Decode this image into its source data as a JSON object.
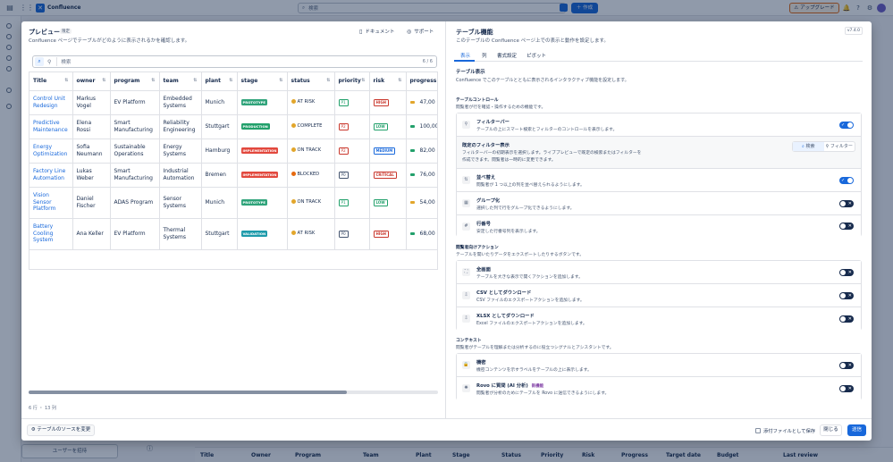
{
  "app": {
    "name": "Confluence",
    "search_placeholder": "検索",
    "create_label": "作成",
    "upgrade_label": "アップグレード",
    "invite_label": "ユーザーを招待"
  },
  "bg_table_headers": [
    "Title",
    "Owner",
    "Program",
    "Team",
    "Plant",
    "Stage",
    "Status",
    "Priority",
    "Risk",
    "Progress",
    "Target date",
    "Budget",
    "Last review"
  ],
  "preview": {
    "title": "プレビュー",
    "badge": "限定",
    "description": "Confluence ページでテーブルがどのように表示されるかを確認します。",
    "doc_link": "ドキュメント",
    "support_link": "サポート",
    "search_placeholder": "検索",
    "count": "6 / 6",
    "row_info": "6 行 ・ 13 列",
    "columns": [
      "Title",
      "owner",
      "program",
      "team",
      "plant",
      "stage",
      "status",
      "priority",
      "risk",
      "progress"
    ],
    "rows": [
      {
        "title": "Control Unit Redesign",
        "owner": "Markus Vogel",
        "program": "EV Platform",
        "team": "Embedded Systems",
        "plant": "Munich",
        "stage": "PROTOTYPE",
        "status": "AT RISK",
        "priority": "P1",
        "risk": "HIGH",
        "progress": "47,00"
      },
      {
        "title": "Predictive Maintenance",
        "owner": "Elena Rossi",
        "program": "Smart Manufacturing",
        "team": "Reliability Engineering",
        "plant": "Stuttgart",
        "stage": "PRODUCTION",
        "status": "COMPLETE",
        "priority": "P2",
        "risk": "LOW",
        "progress": "100,00"
      },
      {
        "title": "Energy Optimization",
        "owner": "Sofia Neumann",
        "program": "Sustainable Operations",
        "team": "Energy Systems",
        "plant": "Hamburg",
        "stage": "IMPLEMENTATION",
        "status": "ON TRACK",
        "priority": "P2",
        "risk": "MEDIUM",
        "progress": "82,00"
      },
      {
        "title": "Factory Line Automation",
        "owner": "Lukas Weber",
        "program": "Smart Manufacturing",
        "team": "Industrial Automation",
        "plant": "Bremen",
        "stage": "IMPLEMENTATION",
        "status": "BLOCKED",
        "priority": "P0",
        "risk": "CRITICAL",
        "progress": "76,00"
      },
      {
        "title": "Vision Sensor Platform",
        "owner": "Daniel Fischer",
        "program": "ADAS Program",
        "team": "Sensor Systems",
        "plant": "Munich",
        "stage": "PROTOTYPE",
        "status": "ON TRACK",
        "priority": "P1",
        "risk": "LOW",
        "progress": "54,00"
      },
      {
        "title": "Battery Cooling System",
        "owner": "Ana Keller",
        "program": "EV Platform",
        "team": "Thermal Systems",
        "plant": "Stuttgart",
        "stage": "VALIDATION",
        "status": "AT RISK",
        "priority": "P0",
        "risk": "HIGH",
        "progress": "68,00"
      }
    ],
    "colors": {
      "stage": {
        "PROTOTYPE": "#2fa37a",
        "PRODUCTION": "#22a06b",
        "IMPLEMENTATION": "#e2483d",
        "VALIDATION": "#1d9aaa"
      },
      "status": {
        "AT RISK": "#e2a62b",
        "COMPLETE": "#e2a62b",
        "ON TRACK": "#e2a62b",
        "BLOCKED": "#e56910"
      },
      "priority": {
        "P1": "#22a06b",
        "P2": "#c9372c",
        "P0": "#44546f"
      },
      "risk": {
        "HIGH": "#c9372c",
        "LOW": "#22a06b",
        "MEDIUM": "#1868db",
        "CRITICAL": "#c9372c"
      },
      "progress": {
        "47,00": "#e2a62b",
        "100,00": "#22a06b",
        "82,00": "#22a06b",
        "76,00": "#22a06b",
        "54,00": "#e2a62b",
        "68,00": "#22a06b"
      }
    }
  },
  "settings": {
    "title": "テーブル機能",
    "description": "このテーブルの Confluence ページ上での表示と動作を設定します。",
    "version": "v7.4.0",
    "tabs": [
      "表示",
      "列",
      "書式設定",
      "ピボット"
    ],
    "display_heading": "テーブル表示",
    "display_desc": "Confluence でこのテーブルとともに表示されるインタラクティブ機能を設定します。",
    "controls_heading": "テーブルコントロール",
    "controls_desc": "閲覧者が行を確認・操作するための機能です。",
    "filterbar_title": "フィルターバー",
    "filterbar_desc": "テーブルの上にスマート検索とフィルターのコントロールを表示します。",
    "default_filter_title": "既定のフィルター表示",
    "default_filter_desc1": "フィルターバーの初期表示を選択します。ライブプレビューで既定の検索またはフィルターを",
    "default_filter_desc2": "作成できます。閲覧者は一時的に変更できます。",
    "seg_search": "検索",
    "seg_filter": "フィルター",
    "sort_title": "並べ替え",
    "sort_desc": "閲覧者が 1 つ以上の列を並べ替えられるようにします。",
    "group_title": "グループ化",
    "group_desc": "選択した列で行をグループ化できるようにします。",
    "rownum_title": "行番号",
    "rownum_desc": "安定した行番号列を表示します。",
    "actions_heading": "閲覧者向けアクション",
    "actions_desc": "テーブルを開いたりデータをエクスポートしたりするボタンです。",
    "fullscreen_title": "全画面",
    "fullscreen_desc": "テーブルを大きな表示で開くアクションを追加します。",
    "csv_title": "CSV としてダウンロード",
    "csv_desc": "CSV ファイルのエクスポートアクションを追加します。",
    "xlsx_title": "XLSX としてダウンロード",
    "xlsx_desc": "Excel ファイルのエクスポートアクションを追加します。",
    "context_heading": "コンテキスト",
    "context_desc": "閲覧者がテーブルを理解または分析するのに役立つシグナルとアシスタントです。",
    "confidential_title": "機密",
    "confidential_desc": "機密コンテンツを示すラベルをテーブルの上に表示します。",
    "rovo_title": "Rovo に質問 (AI 分析)",
    "rovo_badge": "新機能",
    "rovo_desc": "閲覧者が分析のためにテーブルを Rovo に送信できるようにします。"
  },
  "footer": {
    "change_source": "テーブルのソースを変更",
    "save_as_attachment": "添付ファイルとして保存",
    "close": "閉じる",
    "submit": "送信"
  }
}
